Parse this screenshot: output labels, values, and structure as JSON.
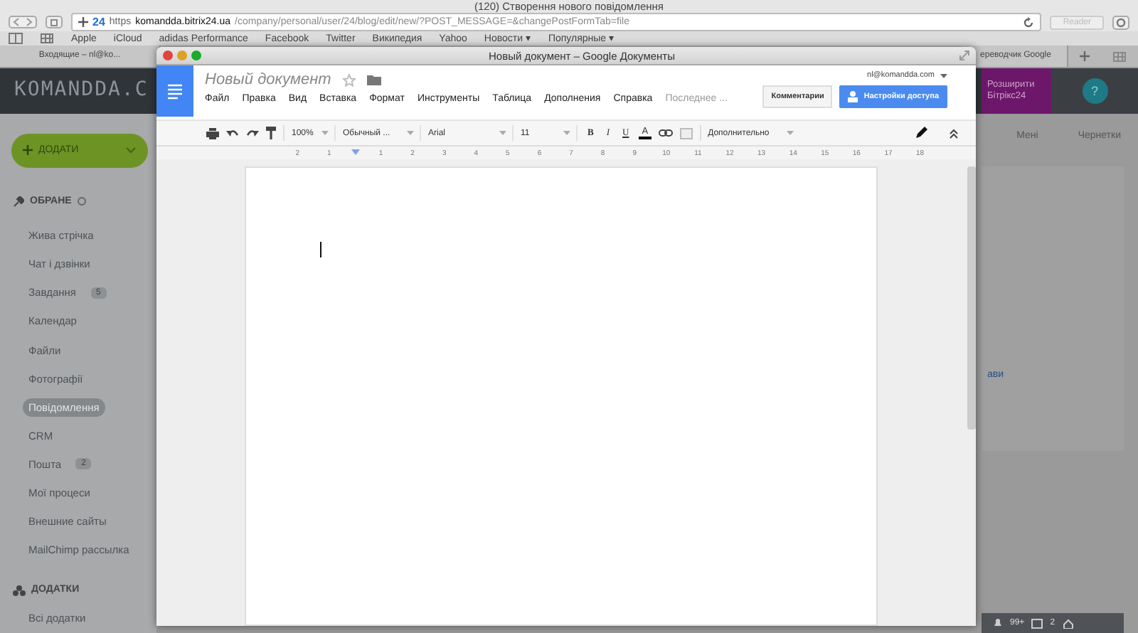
{
  "browser": {
    "title": "(120) Створення нового повідомлення",
    "tab_count": "24",
    "url_scheme": "https",
    "url_host": "komandda.bitrix24.ua",
    "url_path": "/company/personal/user/24/blog/edit/new/?POST_MESSAGE=&changePostFormTab=file",
    "reader": "Reader",
    "bookmarks": [
      "Apple",
      "iCloud",
      "adidas Performance",
      "Facebook",
      "Twitter",
      "Википедия",
      "Yahoo",
      "Новости ▾",
      "Популярные ▾"
    ],
    "tabs": [
      {
        "label": "Входящие – nl@ko...",
        "selected": false
      },
      {
        "label": "ереводчик Google",
        "selected": false
      }
    ]
  },
  "bitrix": {
    "logo": "KOMANDDA.C",
    "upgrade": "Розширити Бітрікс24",
    "help": "?",
    "add_button": "ДОДАТИ",
    "favorites_title": "ОБРАНЕ",
    "items": [
      {
        "label": "Жива стрічка",
        "selected": false
      },
      {
        "label": "Чат і дзвінки",
        "selected": false
      },
      {
        "label": "Завдання",
        "badge": "5",
        "selected": false
      },
      {
        "label": "Календар",
        "selected": false
      },
      {
        "label": "Файли",
        "selected": false
      },
      {
        "label": "Фотографії",
        "selected": false
      },
      {
        "label": "Повідомлення",
        "selected": true
      },
      {
        "label": "CRM",
        "selected": false
      },
      {
        "label": "Пошта",
        "badge": "2",
        "selected": false
      },
      {
        "label": "Мої процеси",
        "selected": false
      },
      {
        "label": "Внешние сайты",
        "selected": false
      },
      {
        "label": "MailChimp рассылка",
        "selected": false
      }
    ],
    "apps_title": "ДОДАТКИ",
    "apps_items": [
      "Всі додатки"
    ],
    "content_tabs": [
      "Мені",
      "Чернетки"
    ],
    "link_fragment": "ави",
    "counters": [
      "99+",
      "2"
    ]
  },
  "doc": {
    "window_title": "Новый документ – Google Документы",
    "doc_title": "Новый документ",
    "account": "nl@komandda.com",
    "menu": [
      "Файл",
      "Правка",
      "Вид",
      "Вставка",
      "Формат",
      "Инструменты",
      "Таблица",
      "Дополнения",
      "Справка"
    ],
    "last_edit": "Последнее ...",
    "comments": "Комментарии",
    "share": "Настройки доступа",
    "zoom": "100%",
    "style": "Обычный ...",
    "font": "Arial",
    "size": "11",
    "format_buttons": [
      {
        "label": "B",
        "kind": "bold"
      },
      {
        "label": "I",
        "kind": "italic"
      },
      {
        "label": "U",
        "kind": "underline"
      },
      {
        "label": "A",
        "kind": "color"
      }
    ],
    "more": "Дополнительно",
    "ruler": [
      "2",
      "1",
      "1",
      "2",
      "3",
      "4",
      "5",
      "6",
      "7",
      "8",
      "9",
      "10",
      "11",
      "12",
      "13",
      "14",
      "15",
      "16",
      "17",
      "18"
    ]
  }
}
